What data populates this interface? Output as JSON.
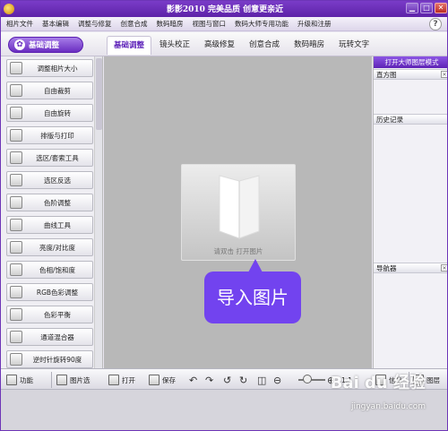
{
  "window": {
    "title": "影影2010  完美品质  创意更亲近",
    "controls": [
      "▁",
      "□",
      "✕"
    ]
  },
  "menu": [
    "相片文件",
    "基本编辑",
    "调整与修复",
    "创意合成",
    "数码暗房",
    "视图与窗口",
    "数码大师专用功能",
    "升级和注册"
  ],
  "help_label": "?",
  "mode_button": {
    "label": "基础调整"
  },
  "tabs": [
    "基础调整",
    "镜头校正",
    "高级修复",
    "创意合成",
    "数码暗房",
    "玩转文字"
  ],
  "tools": [
    "调整相片大小",
    "自由裁剪",
    "自由旋转",
    "排版与打印",
    "选区/套索工具",
    "选区反选",
    "色阶调整",
    "曲线工具",
    "亮度/对比度",
    "色相/饱和度",
    "RGB色彩调整",
    "色彩平衡",
    "通道混合器",
    "逆时针旋转90度"
  ],
  "canvas": {
    "import_hint": "请双击  打开图片",
    "callout": "导入图片"
  },
  "right_panel": {
    "title": "打开大师图层模式",
    "sections": [
      "直方图",
      "历史记录",
      "导航器"
    ]
  },
  "bottom_toolbar": {
    "features": "功能",
    "filmstrip": "图片选",
    "open": "打开",
    "save": "保存",
    "zoom": "1:1",
    "info": "信息",
    "layers": "图层"
  },
  "watermark": {
    "brand": "Bai du 经验",
    "url": "jingyan.baidu.com"
  }
}
